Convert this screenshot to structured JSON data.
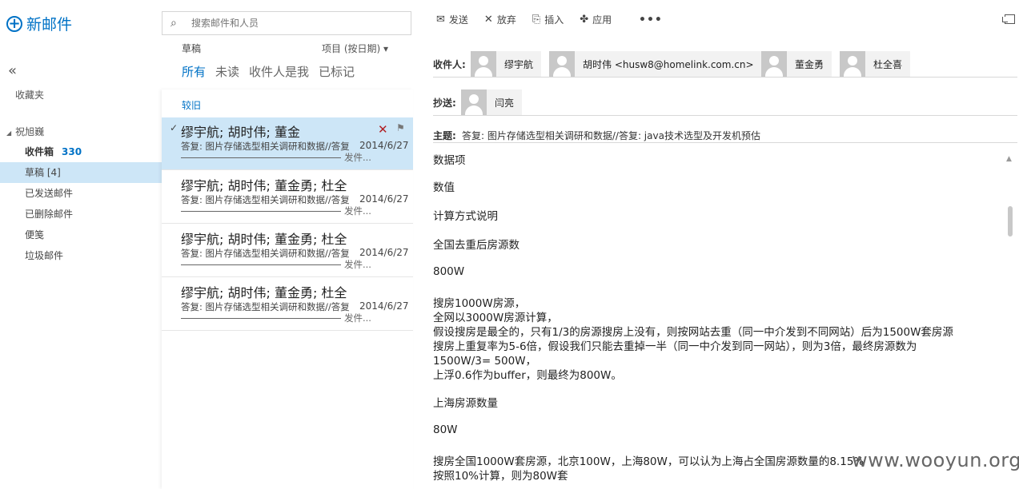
{
  "nav": {
    "new_mail_label": "新邮件",
    "collapse_glyph": "«",
    "favorites_label": "收藏夹",
    "account_label": "祝旭巍",
    "folders": [
      {
        "label": "收件箱",
        "count": "330"
      },
      {
        "label": "草稿 [4]"
      },
      {
        "label": "已发送邮件"
      },
      {
        "label": "已删除邮件"
      },
      {
        "label": "便笺"
      },
      {
        "label": "垃圾邮件"
      }
    ]
  },
  "list": {
    "search_placeholder": "搜索邮件和人员",
    "folder_title": "草稿",
    "sort_label": "项目 (按日期) ▾",
    "filters": [
      "所有",
      "未读",
      "收件人是我",
      "已标记"
    ],
    "group_label": "较旧",
    "items": [
      {
        "from": "缪宇航; 胡时伟; 董金勇; 杜全喜",
        "subject": "答复: 图片存储选型相关调研和数据//答复: java技术选型及开发机预估",
        "date": "2014/6/27",
        "more": "发件..."
      },
      {
        "from": "缪宇航; 胡时伟; 董金勇; 杜全喜",
        "subject": "答复: 图片存储选型相关调研和数据//答复: java技术选型及开发机预估",
        "date": "2014/6/27",
        "more": "发件..."
      },
      {
        "from": "缪宇航; 胡时伟; 董金勇; 杜全喜",
        "subject": "答复: 图片存储选型相关调研和数据//答复: java技术选型及开发机预估",
        "date": "2014/6/27",
        "more": "发件..."
      },
      {
        "from": "缪宇航; 胡时伟; 董金勇; 杜全喜",
        "subject": "答复: 图片存储选型相关调研和数据//答复: java技术选型及开发机预估",
        "date": "2014/6/27",
        "more": "发件..."
      }
    ]
  },
  "compose": {
    "toolbar": {
      "send": "发送",
      "discard": "放弃",
      "insert": "插入",
      "apply": "应用",
      "more": "•••"
    },
    "to_label": "收件人:",
    "to": [
      "缪宇航",
      "胡时伟 <husw8@homelink.com.cn>",
      "董金勇",
      "杜全喜"
    ],
    "cc_label": "抄送:",
    "cc": [
      "闫亮"
    ],
    "subject_label": "主题:",
    "subject": "答复: 图片存储选型相关调研和数据//答复: java技术选型及开发机预估",
    "body": [
      "数据项",
      "数值",
      "计算方式说明",
      "全国去重后房源数",
      "800W",
      "搜房1000W房源，",
      "全网以3000W房源计算，",
      "假设搜房是最全的，只有1/3的房源搜房上没有，则按网站去重（同一中介发到不同网站）后为1500W套房源",
      "搜房上重复率为5-6倍，假设我们只能去重掉一半（同一中介发到同一网站），则为3倍，最终房源数为",
      "1500W/3= 500W，",
      "上浮0.6作为buffer，则最终为800W。",
      "上海房源数量",
      "80W",
      "搜房全国1000W套房源，北京100W，上海80W，可以认为上海占全国房源数量的8.15%",
      "按照10%计算，则为80W套"
    ]
  },
  "watermark": "www.wooyun.org",
  "colors": {
    "accent": "#0072c6",
    "selected": "#cde6f7",
    "delete": "#b01e23"
  }
}
